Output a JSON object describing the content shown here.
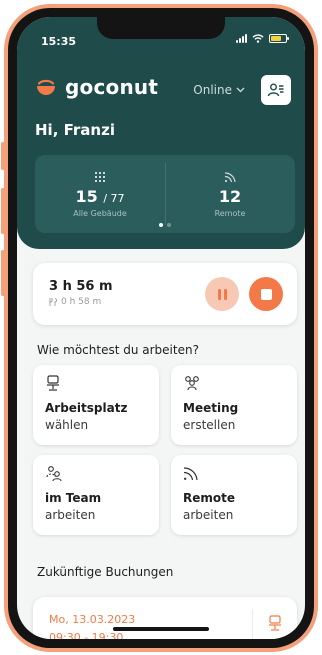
{
  "status_bar": {
    "time": "15:35"
  },
  "header": {
    "brand": "goconut",
    "online_label": "Online",
    "greeting": "Hi, Franzi"
  },
  "stats": [
    {
      "value": "15",
      "total": "/ 77",
      "label": "Alle Gebäude",
      "icon": "building-grid-icon"
    },
    {
      "value": "12",
      "total": "",
      "label": "Remote",
      "icon": "wifi-icon"
    }
  ],
  "timer": {
    "elapsed": "3 h 56 m",
    "break_time": "0 h 58 m"
  },
  "work_section": {
    "title": "Wie möchtest du arbeiten?",
    "tiles": [
      {
        "line1": "Arbeitsplatz",
        "line2": "wählen",
        "icon": "chair-icon"
      },
      {
        "line1": "Meeting",
        "line2": "erstellen",
        "icon": "people-icon"
      },
      {
        "line1": "im Team",
        "line2": "arbeiten",
        "icon": "team-icon"
      },
      {
        "line1": "Remote",
        "line2": "arbeiten",
        "icon": "wifi-icon"
      }
    ]
  },
  "bookings": {
    "title": "Zukünftige Buchungen",
    "items": [
      {
        "date": "Mo, 13.03.2023",
        "time": "09:30 - 19:30",
        "icon": "chair-icon"
      }
    ]
  },
  "colors": {
    "header": "#1f4c4b",
    "accent": "#f37a48",
    "frame": "#f4a07a"
  }
}
